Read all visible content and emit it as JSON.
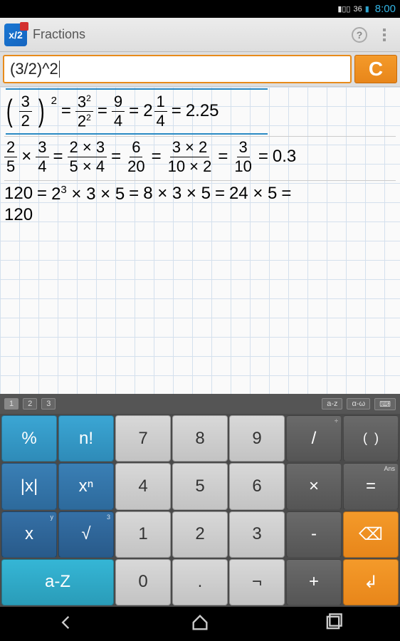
{
  "status": {
    "network": "36",
    "time": "8:00"
  },
  "header": {
    "title": "Fractions"
  },
  "input": {
    "value": "(3/2)^2",
    "clear": "C"
  },
  "results": {
    "line1": {
      "frac1_num": "3",
      "frac1_den": "2",
      "exp1": "2",
      "frac2_num": "3",
      "frac2_numexp": "2",
      "frac2_den": "2",
      "frac2_denexp": "2",
      "frac3_num": "9",
      "frac3_den": "4",
      "mixed_whole": "2",
      "mixed_num": "1",
      "mixed_den": "4",
      "dec": "2.25"
    },
    "line2": {
      "a_num": "2",
      "a_den": "5",
      "b_num": "3",
      "b_den": "4",
      "c_num": "2 × 3",
      "c_den": "5 × 4",
      "d_num": "6",
      "d_den": "20",
      "e_num": "3 × 2",
      "e_den": "10 × 2",
      "f_num": "3",
      "f_den": "10",
      "dec": "0.3"
    },
    "line3": {
      "lhs": "120",
      "t1_base": "2",
      "t1_exp": "3",
      "t1_rest": " × 3 × 5",
      "t2": "8 × 3 × 5",
      "t3": "24 × 5",
      "t4": "120"
    }
  },
  "tabs": {
    "t1": "1",
    "t2": "2",
    "t3": "3",
    "m1": "a-z",
    "m2": "α-ω"
  },
  "keys": {
    "pct": "%",
    "nfact": "n!",
    "k7": "7",
    "k8": "8",
    "k9": "9",
    "div": "/",
    "lp": "(",
    "rp": ")",
    "abs": "|x|",
    "xpow": "xⁿ",
    "k4": "4",
    "k5": "5",
    "k6": "6",
    "mul": "×",
    "eq": "=",
    "xy": "x",
    "sqrt": "√",
    "sqrt_tiny": "3",
    "xy_tiny": "y",
    "k1": "1",
    "k2": "2",
    "k3": "3",
    "minus": "-",
    "bksp": "⌫",
    "aZ": "a-Z",
    "k0": "0",
    "dot": ".",
    "neg": "¬",
    "plus": "+",
    "enter": "↲",
    "div_tiny": "÷",
    "ans_tiny": "Ans"
  }
}
